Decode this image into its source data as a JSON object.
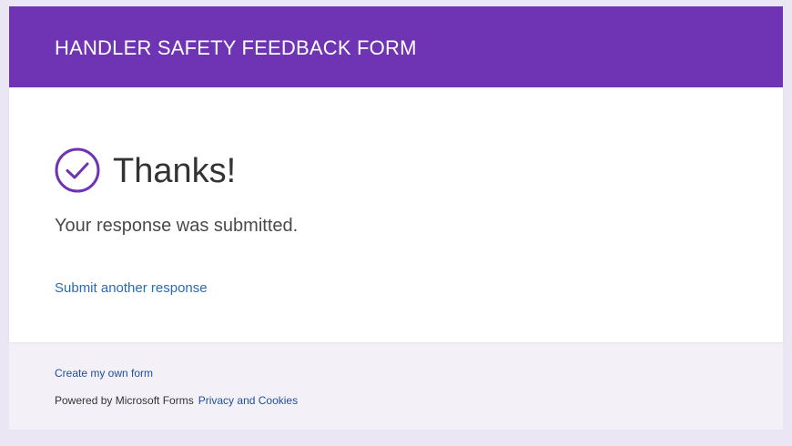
{
  "header": {
    "title": "HANDLER SAFETY FEEDBACK FORM"
  },
  "confirmation": {
    "icon": "checkmark-circle-icon",
    "heading": "Thanks!",
    "message": "Your response was submitted.",
    "submit_another": "Submit another response"
  },
  "footer": {
    "create_form": "Create my own form",
    "powered_by": "Powered by Microsoft Forms",
    "privacy": "Privacy and Cookies"
  },
  "colors": {
    "brand_purple": "#6f34b4",
    "link_blue": "#2b6bb3",
    "page_background": "#ebe6f3"
  }
}
